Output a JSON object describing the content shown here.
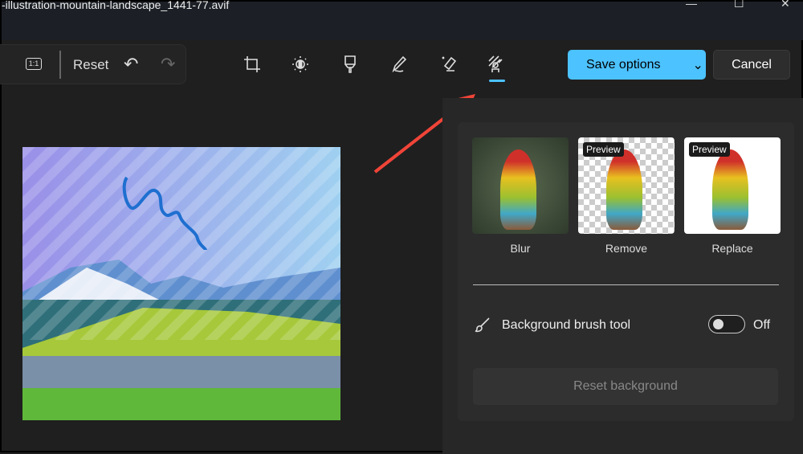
{
  "window": {
    "title": "-illustration-mountain-landscape_1441-77.avif",
    "minimize": "—",
    "maximize": "☐",
    "close": "✕"
  },
  "toolbar": {
    "actual_size": "1:1",
    "reset": "Reset",
    "undo": "↶",
    "redo": "↷",
    "save_options": "Save options",
    "cancel": "Cancel"
  },
  "tools": [
    {
      "name": "crop"
    },
    {
      "name": "adjust"
    },
    {
      "name": "filter"
    },
    {
      "name": "markup"
    },
    {
      "name": "erase"
    },
    {
      "name": "background",
      "active": true
    }
  ],
  "background_panel": {
    "options": [
      {
        "label": "Blur",
        "preview": ""
      },
      {
        "label": "Remove",
        "preview": "Preview"
      },
      {
        "label": "Replace",
        "preview": "Preview"
      }
    ],
    "brush_tool_label": "Background brush tool",
    "toggle_state": "Off",
    "toggle_on": false,
    "reset_background": "Reset background"
  },
  "colors": {
    "accent": "#4cc2ff",
    "arrow": "#f04438"
  }
}
